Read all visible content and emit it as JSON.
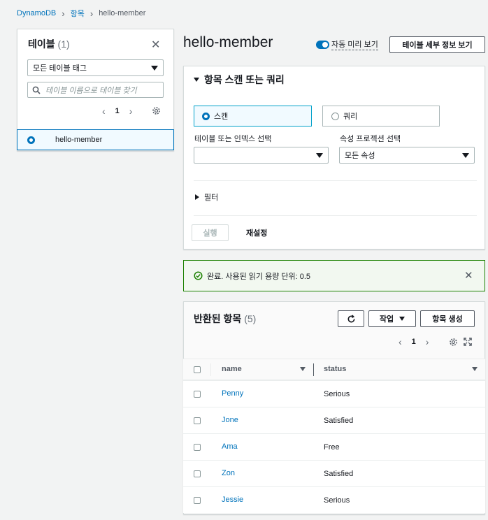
{
  "breadcrumb": {
    "items": [
      "DynamoDB",
      "항목",
      "hello-member"
    ]
  },
  "sidebar": {
    "title": "테이블",
    "count": "(1)",
    "tag_select": "모든 테이블 태그",
    "search_placeholder": "테이블 이름으로 테이블 찾기",
    "page": "1",
    "table_item": "hello-member"
  },
  "header": {
    "title": "hello-member",
    "auto_preview_label": "자동 미리 보기",
    "details_button": "테이블 세부 정보 보기"
  },
  "scan": {
    "section_title": "항목 스캔 또는 쿼리",
    "scan_label": "스캔",
    "query_label": "쿼리",
    "table_index_label": "테이블 또는 인덱스 선택",
    "table_index_value": "",
    "projection_label": "속성 프로젝션 선택",
    "projection_value": "모든 속성",
    "filter_label": "필터",
    "run_button": "실행",
    "reset_button": "재설정"
  },
  "alert": {
    "message": "완료. 사용된 읽기 용량 단위: 0.5",
    "color": "#1d8102"
  },
  "results": {
    "title": "반환된 항목",
    "count": "(5)",
    "actions_button": "작업",
    "create_button": "항목 생성",
    "page": "1",
    "columns": [
      "name",
      "status"
    ],
    "rows": [
      {
        "name": "Penny",
        "status": "Serious"
      },
      {
        "name": "Jone",
        "status": "Satisfied"
      },
      {
        "name": "Ama",
        "status": "Free"
      },
      {
        "name": "Zon",
        "status": "Satisfied"
      },
      {
        "name": "Jessie",
        "status": "Serious"
      }
    ]
  },
  "colors": {
    "accent": "#0073bb",
    "success": "#1d8102"
  }
}
